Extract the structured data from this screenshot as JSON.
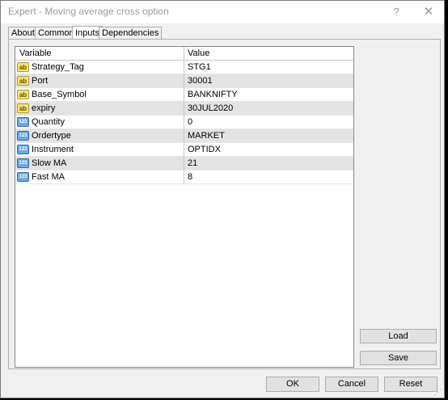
{
  "window": {
    "title": "Expert - Moving average cross option",
    "help_label": "?",
    "close_label": "✕"
  },
  "tabs": [
    {
      "label": "About",
      "active": false
    },
    {
      "label": "Common",
      "active": false
    },
    {
      "label": "Inputs",
      "active": true
    },
    {
      "label": "Dependencies",
      "active": false
    }
  ],
  "grid": {
    "columns": [
      "Variable",
      "Value"
    ],
    "rows": [
      {
        "icon": "ab",
        "variable": "Strategy_Tag",
        "value": "STG1"
      },
      {
        "icon": "ab",
        "variable": "Port",
        "value": "30001"
      },
      {
        "icon": "ab",
        "variable": "Base_Symbol",
        "value": "BANKNIFTY"
      },
      {
        "icon": "ab",
        "variable": "expiry",
        "value": "30JUL2020"
      },
      {
        "icon": "123",
        "variable": "Quantity",
        "value": "0"
      },
      {
        "icon": "123",
        "variable": "Ordertype",
        "value": "MARKET"
      },
      {
        "icon": "123",
        "variable": "Instrument",
        "value": "OPTIDX"
      },
      {
        "icon": "123",
        "variable": "Slow MA",
        "value": "21"
      },
      {
        "icon": "123",
        "variable": "Fast MA",
        "value": "8"
      }
    ]
  },
  "side_buttons": {
    "load": "Load",
    "save": "Save"
  },
  "bottom_buttons": {
    "ok": "OK",
    "cancel": "Cancel",
    "reset": "Reset"
  },
  "colors": {
    "dialog_bg": "#f0f0f0",
    "alt_row": "#e3e3e3",
    "string_icon": "#f4e27a",
    "number_icon": "#6fa8dc"
  }
}
